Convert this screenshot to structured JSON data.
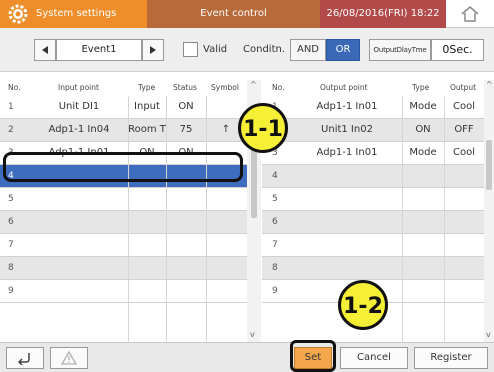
{
  "titlebar": {
    "app_title": "System settings",
    "section_title": "Event control",
    "datetime": "26/08/2016(FRI) 18:22",
    "colors": {
      "orange": "#ee8d2a",
      "brown": "#b96a3a",
      "red": "#b24a4a"
    }
  },
  "controls": {
    "event_name": "Event1",
    "valid_label": "Valid",
    "valid_checked": false,
    "condition_label": "Conditn.",
    "and_label": "AND",
    "or_label": "OR",
    "selected_condition": "OR",
    "output_delay_label": "OutputDlayTme",
    "output_delay_value": "0Sec."
  },
  "input_table": {
    "headers": {
      "no": "No.",
      "input_point": "Input point",
      "type": "Type",
      "status": "Status",
      "symbol": "Symbol"
    },
    "rows": [
      {
        "no": "1",
        "input_point": "Unit DI1",
        "type": "Input",
        "status": "ON",
        "symbol": ""
      },
      {
        "no": "2",
        "input_point": "Adp1-1 In04",
        "type": "Room T",
        "status": "75",
        "symbol": "↑"
      },
      {
        "no": "3",
        "input_point": "Adp1-1 In01",
        "type": "ON",
        "status": "ON",
        "symbol": ""
      },
      {
        "no": "4",
        "input_point": "",
        "type": "",
        "status": "",
        "symbol": ""
      },
      {
        "no": "5",
        "input_point": "",
        "type": "",
        "status": "",
        "symbol": ""
      },
      {
        "no": "6",
        "input_point": "",
        "type": "",
        "status": "",
        "symbol": ""
      },
      {
        "no": "7",
        "input_point": "",
        "type": "",
        "status": "",
        "symbol": ""
      },
      {
        "no": "8",
        "input_point": "",
        "type": "",
        "status": "",
        "symbol": ""
      },
      {
        "no": "9",
        "input_point": "",
        "type": "",
        "status": "",
        "symbol": ""
      }
    ],
    "selected_row": 4
  },
  "output_table": {
    "headers": {
      "no": "No.",
      "output_point": "Output point",
      "type": "Type",
      "output": "Output"
    },
    "rows": [
      {
        "no": "1",
        "output_point": "Adp1-1 In01",
        "type": "Mode",
        "output": "Cool"
      },
      {
        "no": "2",
        "output_point": "Unit1 In02",
        "type": "ON",
        "output": "OFF"
      },
      {
        "no": "3",
        "output_point": "Adp1-1 In01",
        "type": "Mode",
        "output": "Cool"
      },
      {
        "no": "4",
        "output_point": "",
        "type": "",
        "output": ""
      },
      {
        "no": "5",
        "output_point": "",
        "type": "",
        "output": ""
      },
      {
        "no": "6",
        "output_point": "",
        "type": "",
        "output": ""
      },
      {
        "no": "7",
        "output_point": "",
        "type": "",
        "output": ""
      },
      {
        "no": "8",
        "output_point": "",
        "type": "",
        "output": ""
      },
      {
        "no": "9",
        "output_point": "",
        "type": "",
        "output": ""
      }
    ]
  },
  "bottom": {
    "set_label": "Set",
    "cancel_label": "Cancel",
    "register_label": "Register"
  },
  "callouts": {
    "one_one": "1-1",
    "one_two": "1-2"
  }
}
